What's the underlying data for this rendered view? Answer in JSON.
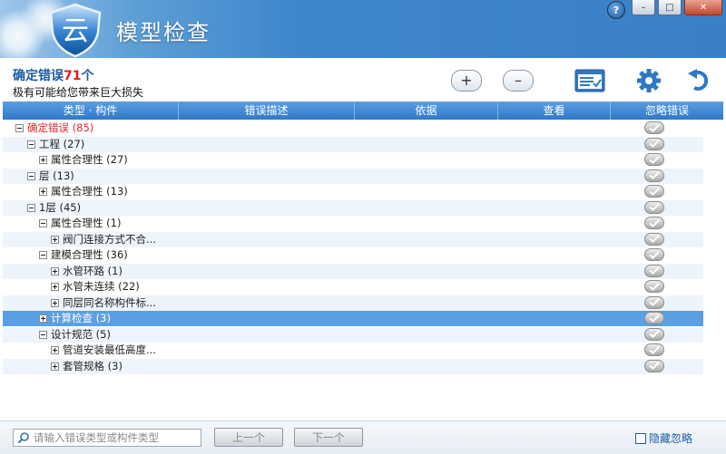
{
  "window": {
    "title": "模型检查",
    "logo_text": "云",
    "buttons": {
      "help": "?",
      "minimize": "–",
      "maximize": "□",
      "close": "✕"
    }
  },
  "summary": {
    "prefix": "确定错误",
    "count": "71",
    "suffix": "个",
    "subtitle": "极有可能给您带来巨大损失"
  },
  "toolbar": {
    "expand_label": "+",
    "collapse_label": "–",
    "icons": [
      "report-icon",
      "gear-icon",
      "undo-icon"
    ]
  },
  "columns": [
    "类型 · 构件",
    "错误描述",
    "依据",
    "查看",
    "忽略错误"
  ],
  "rows": [
    {
      "label": "确定错误 (85)",
      "level": 0,
      "toggle": "minus",
      "style": "red"
    },
    {
      "label": "工程 (27)",
      "level": 1,
      "toggle": "minus"
    },
    {
      "label": "属性合理性 (27)",
      "level": 2,
      "toggle": "plus"
    },
    {
      "label": "层 (13)",
      "level": 1,
      "toggle": "minus"
    },
    {
      "label": "属性合理性 (13)",
      "level": 2,
      "toggle": "plus"
    },
    {
      "label": "1层 (45)",
      "level": 1,
      "toggle": "minus"
    },
    {
      "label": "属性合理性 (1)",
      "level": 2,
      "toggle": "minus"
    },
    {
      "label": "阀门连接方式不合...",
      "level": 3,
      "toggle": "plus"
    },
    {
      "label": "建模合理性 (36)",
      "level": 2,
      "toggle": "minus"
    },
    {
      "label": "水管环路 (1)",
      "level": 3,
      "toggle": "plus"
    },
    {
      "label": "水管未连续 (22)",
      "level": 3,
      "toggle": "plus"
    },
    {
      "label": "同层同名称构件标...",
      "level": 3,
      "toggle": "plus"
    },
    {
      "label": "计算检查 (3)",
      "level": 2,
      "toggle": "plus",
      "selected": true
    },
    {
      "label": "设计规范 (5)",
      "level": 2,
      "toggle": "minus"
    },
    {
      "label": "管道安装最低高度...",
      "level": 3,
      "toggle": "plus"
    },
    {
      "label": "套管规格 (3)",
      "level": 3,
      "toggle": "plus"
    }
  ],
  "footer": {
    "search_placeholder": "请输入错误类型或构件类型",
    "prev_label": "上一个",
    "next_label": "下一个",
    "hide_ignored_label": "隐藏忽略"
  },
  "colors": {
    "accent": "#3a80c6",
    "error_red": "#e3262b",
    "selected_row": "#5b9fe3"
  }
}
